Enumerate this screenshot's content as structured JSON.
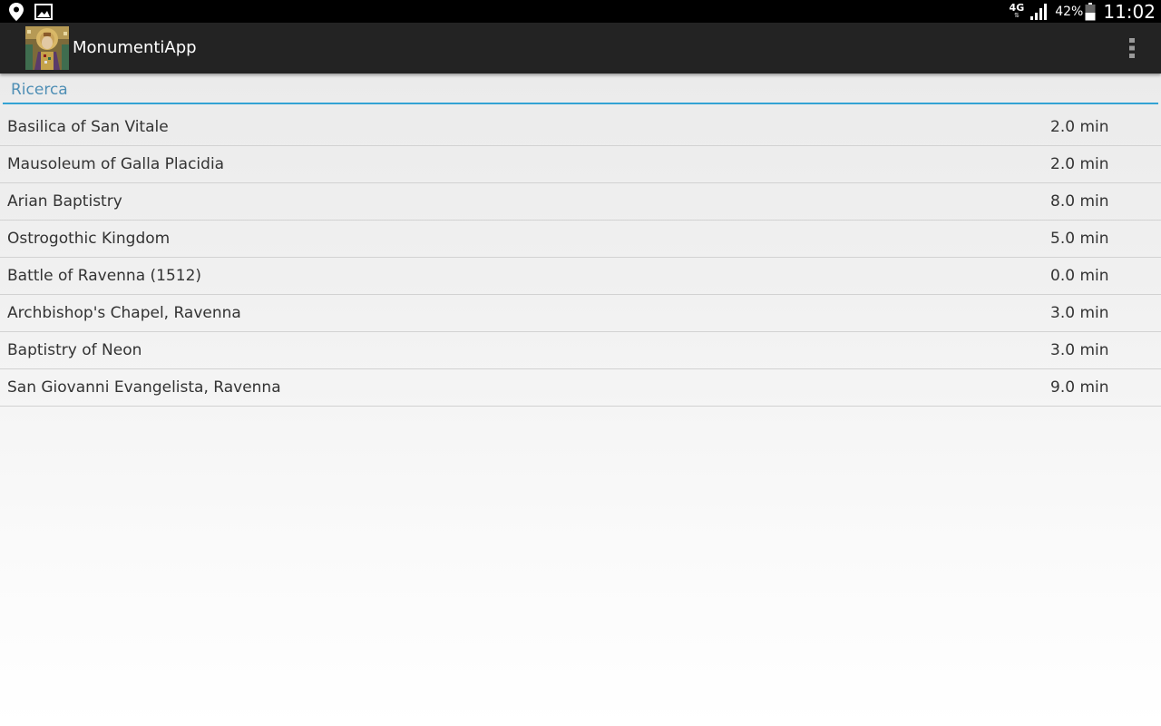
{
  "status_bar": {
    "network_type": "4G",
    "battery_percent": "42%",
    "time": "11:02",
    "icons": [
      "location-icon",
      "image-icon",
      "signal-icon",
      "battery-icon"
    ]
  },
  "action_bar": {
    "title": "MonumentiApp",
    "app_icon": "mosaic-portrait-icon",
    "overflow_icon": "overflow-menu-icon"
  },
  "search": {
    "placeholder": "Ricerca",
    "value": ""
  },
  "monuments": [
    {
      "name": "Basilica of San Vitale",
      "time": "2.0 min"
    },
    {
      "name": "Mausoleum of Galla Placidia",
      "time": "2.0 min"
    },
    {
      "name": "Arian Baptistry",
      "time": "8.0 min"
    },
    {
      "name": "Ostrogothic Kingdom",
      "time": "5.0 min"
    },
    {
      "name": "Battle of Ravenna (1512)",
      "time": "0.0 min"
    },
    {
      "name": "Archbishop's Chapel, Ravenna",
      "time": "3.0 min"
    },
    {
      "name": "Baptistry of Neon",
      "time": "3.0 min"
    },
    {
      "name": "San Giovanni Evangelista, Ravenna",
      "time": "9.0 min"
    }
  ],
  "colors": {
    "accent": "#33a3d4",
    "action_bar": "#232323",
    "status_bar": "#000000"
  }
}
